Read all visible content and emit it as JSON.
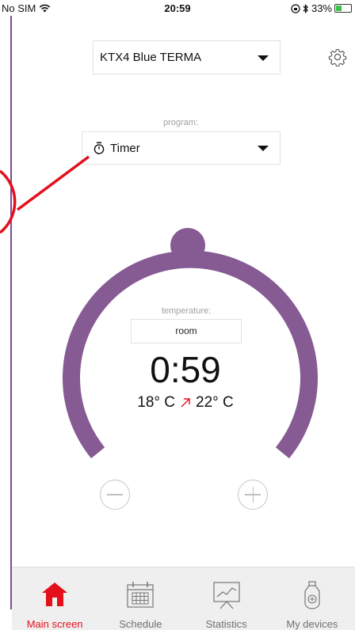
{
  "status_bar": {
    "carrier": "No SIM",
    "time": "20:59",
    "battery_percent": "33%",
    "battery_level": 0.33
  },
  "header": {
    "device_name": "KTX4 Blue TERMA",
    "settings_icon": "gear-icon"
  },
  "program": {
    "label": "program:",
    "selected": "Timer",
    "icon": "stopwatch-icon"
  },
  "dial": {
    "temperature_label": "temperature:",
    "mode": "room",
    "time_value": "0:59",
    "from_temp": "18° C",
    "to_temp": "22° C",
    "colors": {
      "arc": "#865a92",
      "arrow": "#e3101c"
    }
  },
  "controls": {
    "minus_icon": "minus-circle-icon",
    "plus_icon": "plus-circle-icon"
  },
  "tabbar": {
    "tabs": [
      {
        "label": "Main screen",
        "icon": "home-icon",
        "active": true
      },
      {
        "label": "Schedule",
        "icon": "calendar-icon",
        "active": false
      },
      {
        "label": "Statistics",
        "icon": "chart-icon",
        "active": false
      },
      {
        "label": "My devices",
        "icon": "device-icon",
        "active": false
      }
    ],
    "colors": {
      "active": "#e3101c",
      "inactive": "#707070"
    }
  }
}
